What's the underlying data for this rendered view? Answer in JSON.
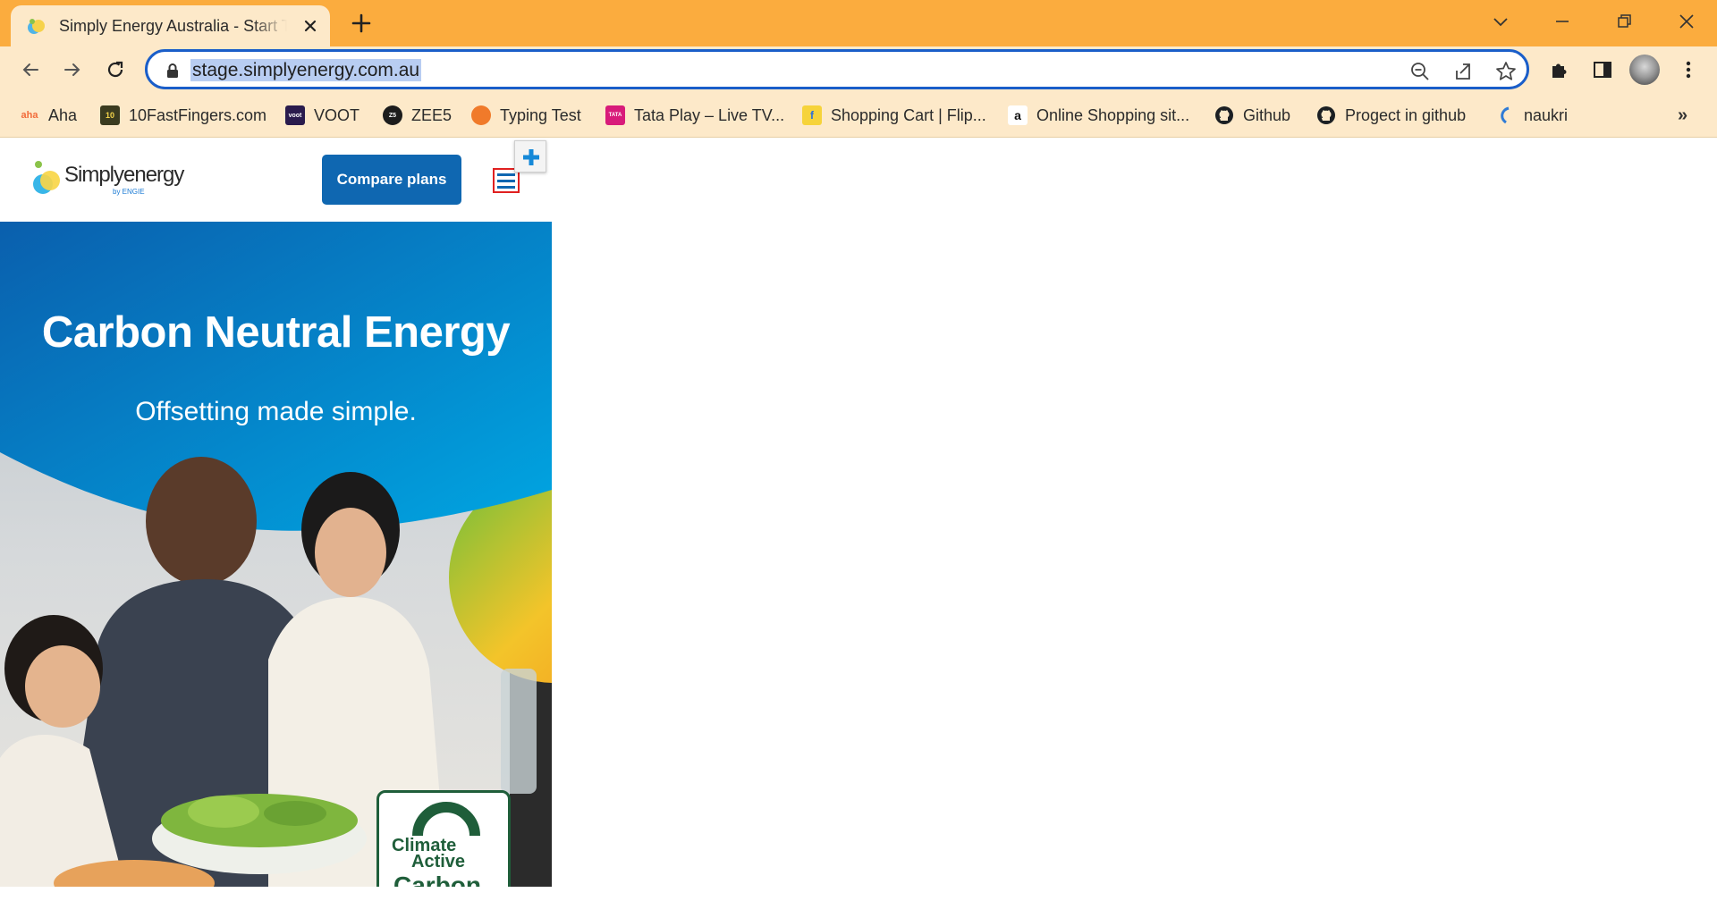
{
  "browser": {
    "tab_title": "Simply Energy Australia - Start Today",
    "url": "stage.simplyenergy.com.au"
  },
  "bookmarks": [
    {
      "label": "Aha",
      "icon": "aha-icon"
    },
    {
      "label": "10FastFingers.com",
      "icon": "10fastfingers-icon"
    },
    {
      "label": "VOOT",
      "icon": "voot-icon"
    },
    {
      "label": "ZEE5",
      "icon": "zee5-icon"
    },
    {
      "label": "Typing Test",
      "icon": "typing-test-icon"
    },
    {
      "label": "Tata Play – Live TV...",
      "icon": "tata-play-icon"
    },
    {
      "label": "Shopping Cart | Flip...",
      "icon": "flipkart-icon"
    },
    {
      "label": "Online Shopping sit...",
      "icon": "amazon-icon"
    },
    {
      "label": "Github",
      "icon": "github-icon"
    },
    {
      "label": "Progect in github",
      "icon": "github-icon"
    },
    {
      "label": "naukri",
      "icon": "naukri-icon"
    }
  ],
  "site": {
    "logo_text_1": "Simply",
    "logo_text_2": "energy",
    "logo_sub": "by ENGIE",
    "compare_label": "Compare plans",
    "hero_title": "Carbon Neutral Energy",
    "hero_subtitle": "Offsetting made simple.",
    "badge_line1": "Climate",
    "badge_line2": "Active",
    "badge_line3": "Carbon"
  },
  "colors": {
    "tabstrip": "#fbac3e",
    "toolbar": "#fde9c9",
    "omnibox_border": "#1a5ec9",
    "brand_blue": "#0f67b1",
    "menu_highlight": "#e02020"
  }
}
